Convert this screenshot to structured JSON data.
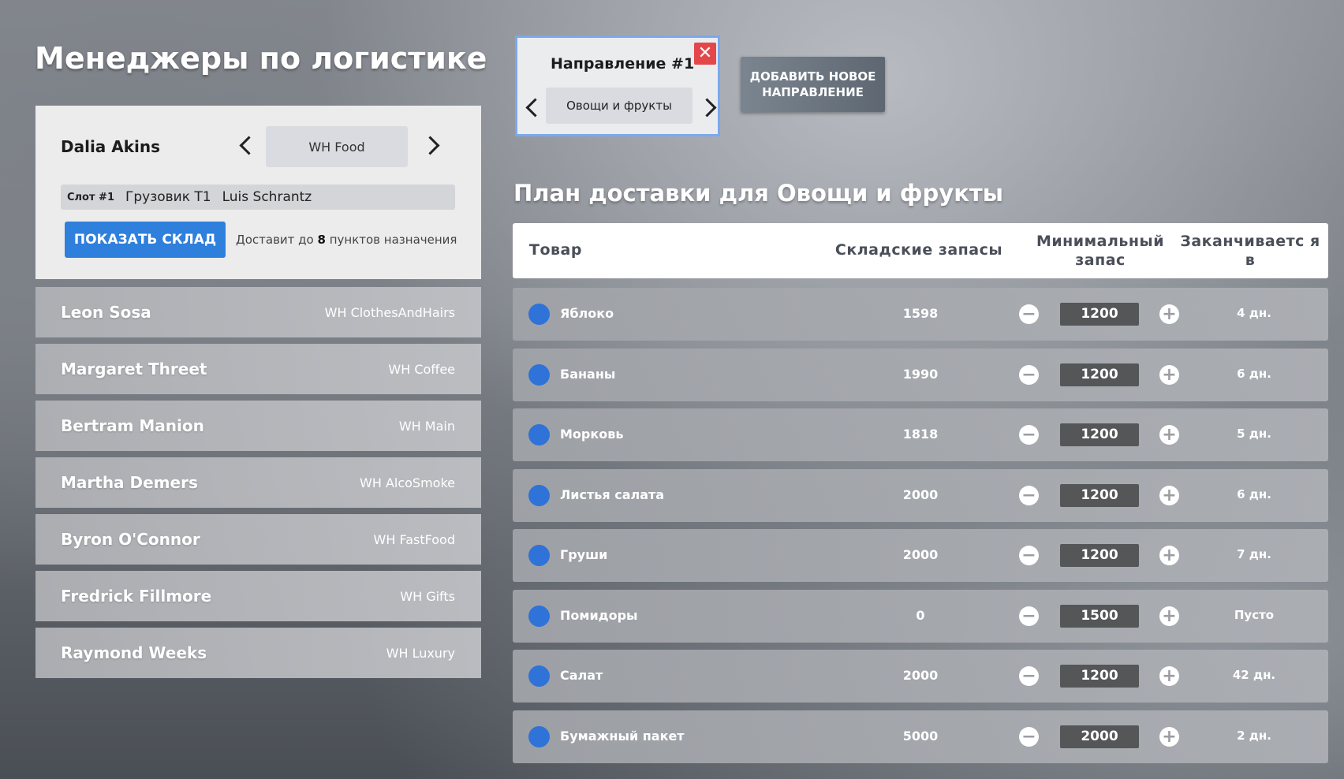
{
  "page_title": "Менеджеры по логистике",
  "selected_manager": {
    "name": "Dalia Akins",
    "warehouse": "WH Food",
    "slot": {
      "number": "Слот #1",
      "vehicle": "Грузовик Т1",
      "driver": "Luis Schrantz"
    },
    "show_button": "ПОКАЗАТЬ СКЛАД",
    "deliver_prefix": "Доставит до",
    "deliver_count": "8",
    "deliver_suffix": "пунктов назначения"
  },
  "managers": [
    {
      "name": "Leon Sosa",
      "warehouse": "WH ClothesAndHairs"
    },
    {
      "name": "Margaret Threet",
      "warehouse": "WH Coffee"
    },
    {
      "name": "Bertram Manion",
      "warehouse": "WH Main"
    },
    {
      "name": "Martha Demers",
      "warehouse": "WH AlcoSmoke"
    },
    {
      "name": "Byron O'Connor",
      "warehouse": "WH FastFood"
    },
    {
      "name": "Fredrick Fillmore",
      "warehouse": "WH Gifts"
    },
    {
      "name": "Raymond Weeks",
      "warehouse": "WH Luxury"
    }
  ],
  "direction": {
    "title": "Направление #1",
    "category": "Овощи и фрукты",
    "close_glyph": "✕"
  },
  "add_direction_button": "ДОБАВИТЬ НОВОЕ НАПРАВЛЕНИЕ",
  "plan": {
    "title": "План доставки для Овощи и фрукты",
    "headers": {
      "good": "Товар",
      "stock": "Складские запасы",
      "min": "Минимальный запас",
      "ends": "Заканчиваетс я в"
    },
    "rows": [
      {
        "name": "Яблоко",
        "stock": "1598",
        "min": "1200",
        "ends": "4 дн."
      },
      {
        "name": "Бананы",
        "stock": "1990",
        "min": "1200",
        "ends": "6 дн."
      },
      {
        "name": "Морковь",
        "stock": "1818",
        "min": "1200",
        "ends": "5 дн."
      },
      {
        "name": "Листья салата",
        "stock": "2000",
        "min": "1200",
        "ends": "6 дн."
      },
      {
        "name": "Груши",
        "stock": "2000",
        "min": "1200",
        "ends": "7 дн."
      },
      {
        "name": "Помидоры",
        "stock": "0",
        "min": "1500",
        "ends": "Пусто"
      },
      {
        "name": "Салат",
        "stock": "2000",
        "min": "1200",
        "ends": "42 дн."
      },
      {
        "name": "Бумажный пакет",
        "stock": "5000",
        "min": "2000",
        "ends": "2 дн."
      }
    ]
  },
  "icons": {
    "minus": "−",
    "plus": "+"
  },
  "colors": {
    "accent_blue": "#2f7fdc",
    "dot_blue": "#2f72d8",
    "close_red": "#e4474a",
    "direction_border": "#7aa8ee"
  }
}
